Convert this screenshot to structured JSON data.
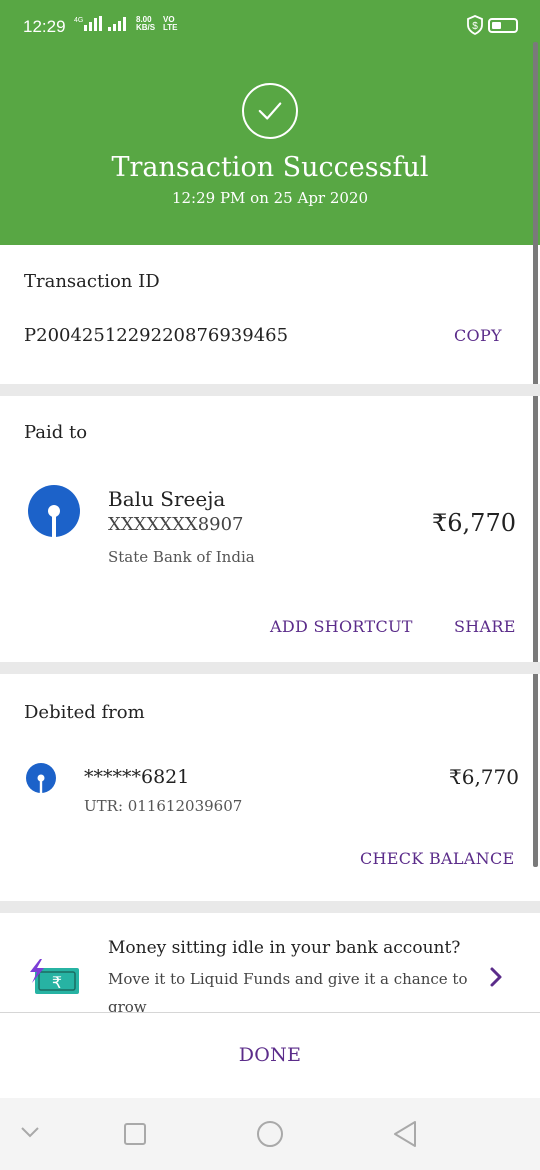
{
  "status_bar": {
    "time": "12:29",
    "network": "4G",
    "speed_value": "8.00",
    "speed_unit": "KB/S",
    "volte_top": "VO",
    "volte_bottom": "LTE",
    "shield_icon": "shield-dollar-icon",
    "battery_icon": "battery-icon"
  },
  "header": {
    "title": "Transaction Successful",
    "subtitle": "12:29 PM on 25 Apr 2020",
    "icon": "check-circle-icon",
    "bg_color": "#58a744"
  },
  "transaction": {
    "label": "Transaction ID",
    "id": "P2004251229220876939465",
    "copy_label": "COPY"
  },
  "paid_to": {
    "label": "Paid to",
    "name": "Balu Sreeja",
    "account": "XXXXXXX8907",
    "bank": "State Bank of India",
    "amount": "₹6,770",
    "add_shortcut_label": "ADD SHORTCUT",
    "share_label": "SHARE",
    "icon": "sbi-logo-icon"
  },
  "debited_from": {
    "label": "Debited from",
    "account": "******6821",
    "utr": "UTR: 011612039607",
    "amount": "₹6,770",
    "check_balance_label": "CHECK BALANCE",
    "icon": "sbi-logo-icon"
  },
  "promo": {
    "title": "Money sitting idle in your bank account?",
    "body_line1": "Move it to Liquid Funds and give it a chance to",
    "body_line2": "grow",
    "icon": "money-transfer-icon",
    "chevron_icon": "chevron-right-icon"
  },
  "done_label": "DONE",
  "nav": {
    "down": "chevron-down-icon",
    "recents": "square-icon",
    "home": "circle-icon",
    "back": "triangle-back-icon"
  },
  "colors": {
    "accent": "#5b2c8a",
    "success": "#58a744",
    "sbi_blue": "#1c62c9"
  }
}
